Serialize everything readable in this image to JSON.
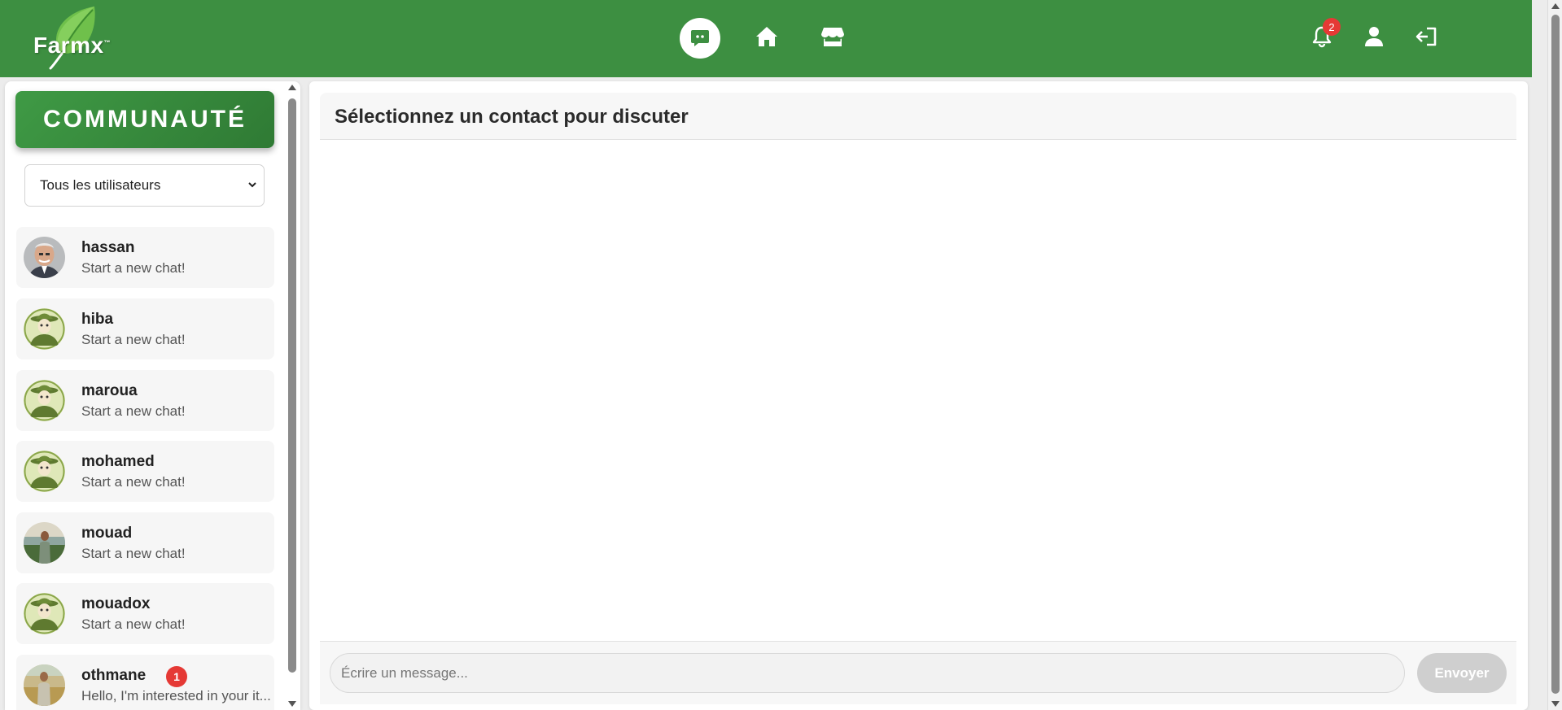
{
  "header": {
    "logo_text": "Farmx",
    "logo_mark": "™",
    "notification_count": "2",
    "nav_icons": [
      "chat-icon",
      "home-icon",
      "store-icon",
      "bell-icon",
      "user-icon",
      "logout-icon"
    ]
  },
  "sidebar": {
    "title": "COMMUNAUTÉ",
    "filter_value": "Tous les utilisateurs",
    "contacts": [
      {
        "name": "hassan",
        "message": "Start a new chat!",
        "avatar": "photo-elderly-man"
      },
      {
        "name": "hiba",
        "message": "Start a new chat!",
        "avatar": "farmer-illustration"
      },
      {
        "name": "maroua",
        "message": "Start a new chat!",
        "avatar": "farmer-illustration"
      },
      {
        "name": "mohamed",
        "message": "Start a new chat!",
        "avatar": "farmer-illustration"
      },
      {
        "name": "mouad",
        "message": "Start a new chat!",
        "avatar": "photo-man-field"
      },
      {
        "name": "mouadox",
        "message": "Start a new chat!",
        "avatar": "farmer-illustration"
      },
      {
        "name": "othmane",
        "message": "Hello, I'm interested in your it...",
        "avatar": "photo-farmer-wheat",
        "unread": "1"
      }
    ]
  },
  "chat": {
    "title": "Sélectionnez un contact pour discuter",
    "input_placeholder": "Écrire un message...",
    "send_label": "Envoyer"
  },
  "colors": {
    "header_green": "#3d8f41",
    "badge_red": "#e53935",
    "send_disabled": "#cfcfcf"
  }
}
